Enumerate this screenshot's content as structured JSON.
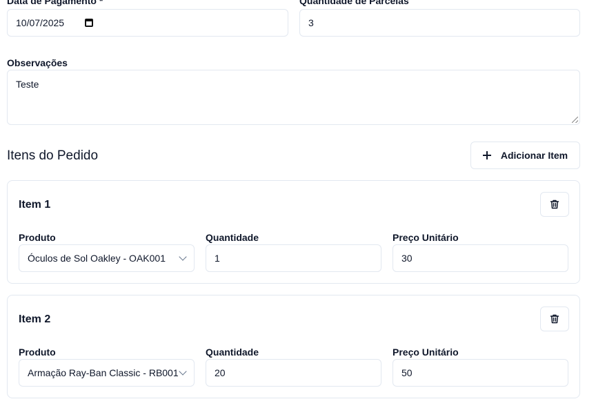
{
  "payment": {
    "date_label": "Data de Pagamento *",
    "date_value": "10/07/2025",
    "installments_label": "Quantidade de Parcelas",
    "installments_value": "3"
  },
  "notes": {
    "label": "Observações",
    "value": "Teste"
  },
  "items_section": {
    "title": "Itens do Pedido",
    "add_button_label": "Adicionar Item"
  },
  "items": [
    {
      "title": "Item 1",
      "product_label": "Produto",
      "product_value": "Óculos de Sol Oakley - OAK001",
      "quantity_label": "Quantidade",
      "quantity_value": "1",
      "price_label": "Preço Unitário",
      "price_value": "30"
    },
    {
      "title": "Item 2",
      "product_label": "Produto",
      "product_value": "Armação Ray-Ban Classic - RB001",
      "quantity_label": "Quantidade",
      "quantity_value": "20",
      "price_label": "Preço Unitário",
      "price_value": "50"
    }
  ],
  "icons": {
    "calendar": "calendar-icon",
    "plus": "plus-icon",
    "trash": "trash-icon",
    "chevron": "chevron-down-icon"
  }
}
